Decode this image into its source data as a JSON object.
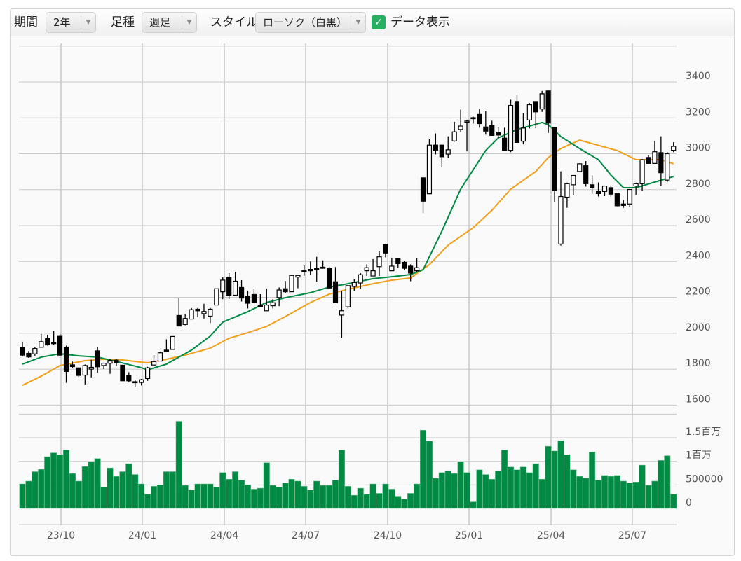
{
  "toolbar": {
    "period_label": "期間",
    "period_value": "2年",
    "interval_label": "足種",
    "interval_value": "週足",
    "style_label": "スタイル",
    "style_value": "ローソク（白黒）",
    "data_display_label": "データ表示",
    "data_display_checked": true,
    "checkbox_color": "#27ae60"
  },
  "chart_data": {
    "type": "candlestick",
    "title": "",
    "x_tick_labels": [
      "23/10",
      "24/01",
      "24/04",
      "24/07",
      "24/10",
      "25/01",
      "25/04",
      "25/07"
    ],
    "price_axis": {
      "ticks": [
        "1600",
        "1800",
        "2000",
        "2200",
        "2400",
        "2600",
        "2800",
        "3000",
        "3200",
        "3400"
      ],
      "range": [
        1600,
        3600
      ],
      "position": "right"
    },
    "volume_axis": {
      "ticks": [
        "0",
        "500000",
        "1百万",
        "1.5百万"
      ],
      "range": [
        0,
        2000000
      ]
    },
    "grid": true,
    "colors": {
      "up_body": "#ffffff",
      "down_body": "#000000",
      "volume": "#008a44",
      "ma_short": "#008a44",
      "ma_long": "#f0a01c"
    },
    "candles_ohlc": [
      [
        1922,
        1953,
        1871,
        1878
      ],
      [
        1888,
        1901,
        1863,
        1868
      ],
      [
        1885,
        1924,
        1875,
        1915
      ],
      [
        1922,
        1996,
        1922,
        1953
      ],
      [
        1970,
        1990,
        1931,
        1935
      ],
      [
        1948,
        2013,
        1937,
        1942
      ],
      [
        1983,
        1996,
        1872,
        1878
      ],
      [
        1922,
        1931,
        1724,
        1787
      ],
      [
        1824,
        1842,
        1807,
        1814
      ],
      [
        1807,
        1807,
        1757,
        1765
      ],
      [
        1767,
        1826,
        1715,
        1820
      ],
      [
        1800,
        1852,
        1754,
        1810
      ],
      [
        1902,
        1922,
        1780,
        1813
      ],
      [
        1820,
        1836,
        1800,
        1833
      ],
      [
        1833,
        1859,
        1774,
        1848
      ],
      [
        1850,
        1856,
        1817,
        1837
      ],
      [
        1822,
        1822,
        1735,
        1735
      ],
      [
        1763,
        1783,
        1728,
        1735
      ],
      [
        1730,
        1741,
        1700,
        1726
      ],
      [
        1726,
        1746,
        1709,
        1741
      ],
      [
        1748,
        1813,
        1735,
        1807
      ],
      [
        1823,
        1878,
        1819,
        1842
      ],
      [
        1845,
        1897,
        1845,
        1891
      ],
      [
        1906,
        1966,
        1899,
        1899
      ],
      [
        1910,
        1984,
        1910,
        1982
      ],
      [
        2099,
        2196,
        2040,
        2040
      ],
      [
        2049,
        2109,
        2044,
        2082
      ],
      [
        2079,
        2141,
        2077,
        2131
      ],
      [
        2134,
        2141,
        2090,
        2125
      ],
      [
        2109,
        2164,
        2082,
        2121
      ],
      [
        2095,
        2141,
        2057,
        2134
      ],
      [
        2157,
        2248,
        2157,
        2248
      ],
      [
        2231,
        2313,
        2190,
        2296
      ],
      [
        2313,
        2335,
        2190,
        2209
      ],
      [
        2212,
        2343,
        2212,
        2290
      ],
      [
        2255,
        2296,
        2177,
        2196
      ],
      [
        2205,
        2235,
        2138,
        2167
      ],
      [
        2216,
        2248,
        2170,
        2170
      ],
      [
        2157,
        2218,
        2144,
        2147
      ],
      [
        2125,
        2248,
        2125,
        2157
      ],
      [
        2153,
        2190,
        2138,
        2170
      ],
      [
        2199,
        2255,
        2151,
        2241
      ],
      [
        2248,
        2291,
        2222,
        2231
      ],
      [
        2231,
        2326,
        2231,
        2322
      ],
      [
        2313,
        2326,
        2251,
        2322
      ],
      [
        2348,
        2378,
        2320,
        2343
      ],
      [
        2356,
        2400,
        2326,
        2348
      ],
      [
        2361,
        2426,
        2287,
        2355
      ],
      [
        2368,
        2406,
        2362,
        2362
      ],
      [
        2361,
        2371,
        2252,
        2252
      ],
      [
        2287,
        2369,
        2170,
        2170
      ],
      [
        2101,
        2235,
        1975,
        2125
      ],
      [
        2147,
        2268,
        2138,
        2265
      ],
      [
        2261,
        2300,
        2235,
        2283
      ],
      [
        2280,
        2335,
        2248,
        2326
      ],
      [
        2348,
        2384,
        2319,
        2365
      ],
      [
        2319,
        2413,
        2319,
        2348
      ],
      [
        2371,
        2456,
        2319,
        2426
      ],
      [
        2495,
        2499,
        2423,
        2447
      ],
      [
        2348,
        2421,
        2348,
        2374
      ],
      [
        2417,
        2417,
        2365,
        2388
      ],
      [
        2395,
        2404,
        2352,
        2362
      ],
      [
        2374,
        2384,
        2290,
        2335
      ],
      [
        2348,
        2417,
        2339,
        2365
      ],
      [
        2866,
        2866,
        2670,
        2736
      ],
      [
        2777,
        3080,
        2775,
        3048
      ],
      [
        3048,
        3113,
        2996,
        3019
      ],
      [
        3048,
        3048,
        2924,
        2983
      ],
      [
        2998,
        3097,
        2976,
        3022
      ],
      [
        3071,
        3178,
        3067,
        3122
      ],
      [
        3135,
        3246,
        3119,
        3154
      ],
      [
        3178,
        3187,
        3013,
        3182
      ],
      [
        3201,
        3207,
        3168,
        3195
      ],
      [
        3219,
        3249,
        3145,
        3168
      ],
      [
        3149,
        3236,
        3106,
        3126
      ],
      [
        3158,
        3184,
        3102,
        3102
      ],
      [
        3117,
        3148,
        3080,
        3104
      ],
      [
        3087,
        3145,
        3019,
        3019
      ],
      [
        3019,
        3301,
        3009,
        3269
      ],
      [
        3291,
        3327,
        3063,
        3063
      ],
      [
        3070,
        3226,
        3052,
        3143
      ],
      [
        3188,
        3282,
        3141,
        3273
      ],
      [
        3291,
        3291,
        3141,
        3233
      ],
      [
        3249,
        3350,
        3233,
        3334
      ],
      [
        3350,
        3350,
        3116,
        3171
      ],
      [
        3148,
        3148,
        2733,
        2794
      ],
      [
        2497,
        2902,
        2488,
        2762
      ],
      [
        2758,
        2839,
        2699,
        2833
      ],
      [
        2827,
        2879,
        2768,
        2879
      ],
      [
        2901,
        2946,
        2899,
        2944
      ],
      [
        2933,
        2959,
        2817,
        2833
      ],
      [
        2827,
        2879,
        2777,
        2810
      ],
      [
        2790,
        2840,
        2762,
        2778
      ],
      [
        2790,
        2823,
        2764,
        2820
      ],
      [
        2811,
        2820,
        2762,
        2775
      ],
      [
        2777,
        2777,
        2707,
        2710
      ],
      [
        2720,
        2742,
        2699,
        2712
      ],
      [
        2720,
        2801,
        2703,
        2801
      ],
      [
        2820,
        2839,
        2772,
        2833
      ],
      [
        2833,
        2970,
        2794,
        2966
      ],
      [
        2979,
        2992,
        2944,
        2946
      ],
      [
        2946,
        3071,
        2944,
        3011
      ],
      [
        3006,
        3097,
        2820,
        2894
      ],
      [
        2853,
        3009,
        2843,
        3000
      ],
      [
        3019,
        3064,
        3009,
        3041
      ]
    ],
    "volume": [
      520000,
      580000,
      780000,
      830000,
      1100000,
      1180000,
      1140000,
      1240000,
      740000,
      580000,
      890000,
      990000,
      1060000,
      450000,
      860000,
      680000,
      780000,
      950000,
      720000,
      520000,
      300000,
      470000,
      500000,
      780000,
      780000,
      1850000,
      490000,
      390000,
      520000,
      520000,
      520000,
      450000,
      760000,
      620000,
      780000,
      600000,
      500000,
      410000,
      430000,
      970000,
      490000,
      450000,
      540000,
      620000,
      580000,
      470000,
      390000,
      580000,
      490000,
      490000,
      600000,
      1240000,
      470000,
      280000,
      430000,
      300000,
      520000,
      320000,
      520000,
      410000,
      260000,
      200000,
      320000,
      520000,
      1660000,
      1430000,
      640000,
      760000,
      800000,
      740000,
      990000,
      760000,
      140000,
      820000,
      720000,
      620000,
      800000,
      1240000,
      880000,
      820000,
      880000,
      760000,
      950000,
      620000,
      1320000,
      1220000,
      1440000,
      1140000,
      820000,
      680000,
      640000,
      1200000,
      600000,
      700000,
      680000,
      700000,
      580000,
      540000,
      560000,
      920000,
      490000,
      580000,
      1020000,
      1120000,
      300000
    ],
    "ma_short": [
      [
        0,
        1828
      ],
      [
        3,
        1867
      ],
      [
        6,
        1886
      ],
      [
        9,
        1874
      ],
      [
        12,
        1867
      ],
      [
        15,
        1843
      ],
      [
        19,
        1808
      ],
      [
        20,
        1796
      ],
      [
        23,
        1828
      ],
      [
        27,
        1906
      ],
      [
        30,
        1984
      ],
      [
        32,
        2062
      ],
      [
        36,
        2120
      ],
      [
        39,
        2171
      ],
      [
        42,
        2198
      ],
      [
        46,
        2226
      ],
      [
        49,
        2257
      ],
      [
        52,
        2276
      ],
      [
        56,
        2304
      ],
      [
        59,
        2315
      ],
      [
        62,
        2327
      ],
      [
        64,
        2354
      ],
      [
        67,
        2569
      ],
      [
        70,
        2803
      ],
      [
        74,
        3018
      ],
      [
        76,
        3088
      ],
      [
        79,
        3135
      ],
      [
        83,
        3174
      ],
      [
        84,
        3162
      ],
      [
        86,
        3096
      ],
      [
        89,
        3029
      ],
      [
        92,
        2967
      ],
      [
        94,
        2881
      ],
      [
        96,
        2811
      ],
      [
        98,
        2811
      ],
      [
        101,
        2842
      ],
      [
        104,
        2873
      ]
    ],
    "ma_long": [
      [
        0,
        1710
      ],
      [
        3,
        1761
      ],
      [
        6,
        1820
      ],
      [
        10,
        1847
      ],
      [
        13,
        1855
      ],
      [
        16,
        1851
      ],
      [
        20,
        1835
      ],
      [
        23,
        1855
      ],
      [
        26,
        1878
      ],
      [
        30,
        1917
      ],
      [
        33,
        1972
      ],
      [
        36,
        2003
      ],
      [
        39,
        2038
      ],
      [
        42,
        2093
      ],
      [
        46,
        2171
      ],
      [
        49,
        2218
      ],
      [
        52,
        2245
      ],
      [
        56,
        2276
      ],
      [
        59,
        2296
      ],
      [
        62,
        2308
      ],
      [
        65,
        2382
      ],
      [
        68,
        2491
      ],
      [
        72,
        2588
      ],
      [
        75,
        2686
      ],
      [
        78,
        2803
      ],
      [
        82,
        2901
      ],
      [
        84,
        2979
      ],
      [
        86,
        3029
      ],
      [
        89,
        3076
      ],
      [
        93,
        3037
      ],
      [
        95,
        3018
      ],
      [
        98,
        2967
      ],
      [
        102,
        2967
      ],
      [
        104,
        2944
      ]
    ]
  }
}
